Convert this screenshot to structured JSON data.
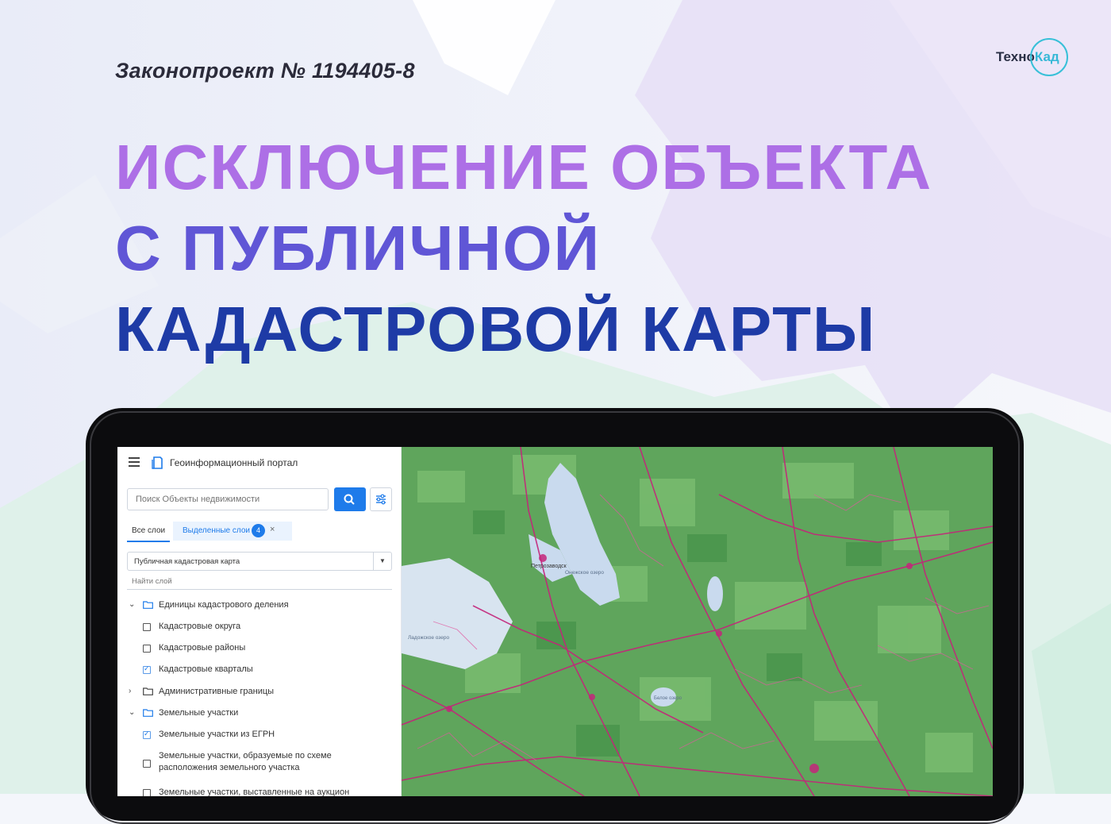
{
  "brand": {
    "logo_part1": "Техно",
    "logo_part2": "Кад"
  },
  "bill_label": "Законопроект № 1194405-8",
  "headline": {
    "line1": "ИСКЛЮЧЕНИЕ ОБЪЕКТА",
    "line2": "С ПУБЛИЧНОЙ",
    "line3": "КАДАСТРОВОЙ КАРТЫ"
  },
  "colors": {
    "headline_top": "#ad6fe6",
    "headline_mid": "#6056d6",
    "headline_bottom": "#1e3ba6",
    "accent": "#1e7bea",
    "logo_ring": "#38c0d8"
  },
  "portal": {
    "title": "Геоинформационный портал",
    "icons": {
      "menu": "hamburger-icon",
      "portal": "portal-logo-icon",
      "collapse": "double-chevron-left-icon"
    }
  },
  "search": {
    "placeholder": "Поиск Объекты недвижимости",
    "button_icon": "search-icon",
    "filter_icon": "filter-sliders-icon"
  },
  "tabs": {
    "all": "Все слои",
    "selected": "Выделенные слои",
    "selected_count": "4"
  },
  "basemap_select": {
    "value": "Публичная кадастровая карта"
  },
  "layer_search": {
    "placeholder": "Найти слой"
  },
  "layer_tree": [
    {
      "type": "group",
      "expanded": true,
      "label": "Единицы кадастрового деления"
    },
    {
      "type": "layer",
      "checked": false,
      "label": "Кадастровые округа"
    },
    {
      "type": "layer",
      "checked": false,
      "label": "Кадастровые районы"
    },
    {
      "type": "layer",
      "checked": true,
      "label": "Кадастровые кварталы"
    },
    {
      "type": "group",
      "expanded": false,
      "label": "Административные границы"
    },
    {
      "type": "group",
      "expanded": true,
      "label": "Земельные участки"
    },
    {
      "type": "layer",
      "checked": true,
      "label": "Земельные участки из ЕГРН"
    },
    {
      "type": "layer",
      "checked": false,
      "label_line1": "Земельные участки, образуемые по схеме",
      "label_line2": "расположения земельного участка"
    },
    {
      "type": "layer",
      "checked": false,
      "label": "Земельные участки, выставленные на аукцион"
    }
  ],
  "map": {
    "labels": {
      "lake_onega": "Онежское озеро",
      "lake_ladoga": "Ладожское озеро",
      "lake_beloe": "Белое озеро",
      "city": "Петрозаводск"
    }
  }
}
